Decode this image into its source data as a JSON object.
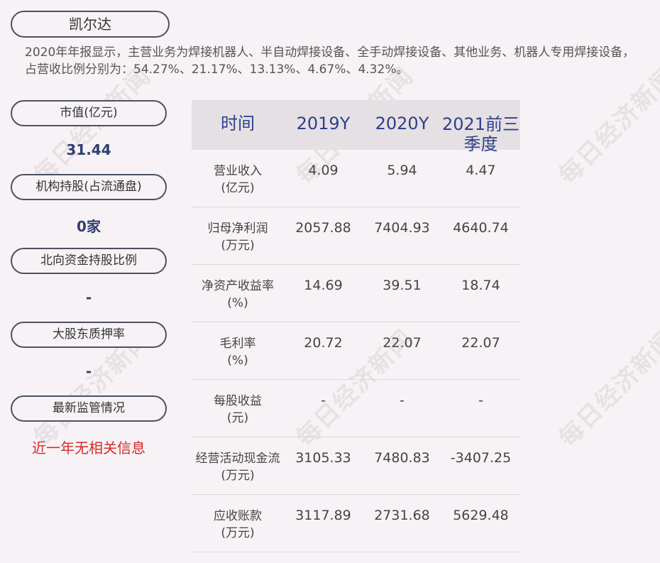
{
  "company": "凯尔达",
  "summary": "2020年年报显示，主营业务为焊接机器人、半自动焊接设备、全手动焊接设备、其他业务、机器人专用焊接设备，占营收比例分别为：54.27%、21.17%、13.13%、4.67%、4.32%。",
  "side": {
    "market_cap_label": "市值(亿元)",
    "market_cap_value": "31.44",
    "inst_label": "机构持股(占流通盘)",
    "inst_value": "0家",
    "north_label": "北向资金持股比例",
    "north_value": "-",
    "pledge_label": "大股东质押率",
    "pledge_value": "-",
    "reg_label": "最新监管情况",
    "reg_value": "近一年无相关信息"
  },
  "table": {
    "headers": [
      "时间",
      "2019Y",
      "2020Y",
      "2021前三季度"
    ],
    "rows": [
      {
        "label": "营业收入",
        "unit": "(亿元)",
        "values": [
          "4.09",
          "5.94",
          "4.47"
        ]
      },
      {
        "label": "归母净利润",
        "unit": "(万元)",
        "values": [
          "2057.88",
          "7404.93",
          "4640.74"
        ]
      },
      {
        "label": "净资产收益率",
        "unit": "(%)",
        "values": [
          "14.69",
          "39.51",
          "18.74"
        ]
      },
      {
        "label": "毛利率",
        "unit": "(%)",
        "values": [
          "20.72",
          "22.07",
          "22.07"
        ]
      },
      {
        "label": "每股收益",
        "unit": "(元)",
        "values": [
          "-",
          "-",
          "-"
        ]
      },
      {
        "label": "经营活动现金流",
        "unit": "(万元)",
        "values": [
          "3105.33",
          "7480.83",
          "-3407.25"
        ]
      },
      {
        "label": "应收账款",
        "unit": "(万元)",
        "values": [
          "3117.89",
          "2731.68",
          "5629.48"
        ]
      }
    ]
  },
  "watermark": "每日经济新闻"
}
